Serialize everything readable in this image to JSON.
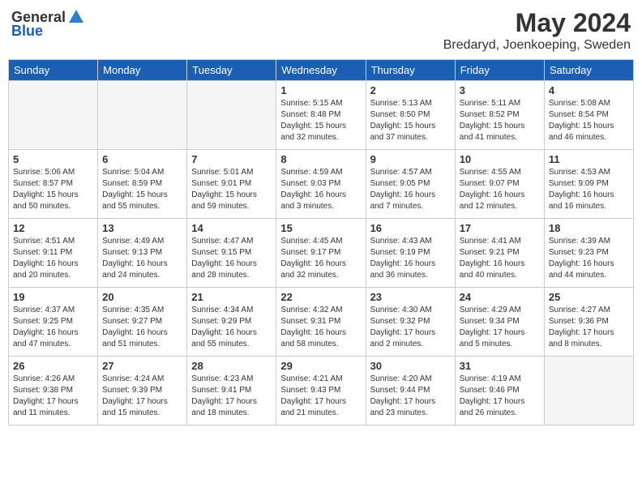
{
  "logo": {
    "general": "General",
    "blue": "Blue",
    "tagline": ""
  },
  "title": {
    "month_year": "May 2024",
    "location": "Bredaryd, Joenkoeping, Sweden"
  },
  "weekdays": [
    "Sunday",
    "Monday",
    "Tuesday",
    "Wednesday",
    "Thursday",
    "Friday",
    "Saturday"
  ],
  "days": [
    {
      "date": "",
      "info": ""
    },
    {
      "date": "",
      "info": ""
    },
    {
      "date": "",
      "info": ""
    },
    {
      "date": "1",
      "sunrise": "Sunrise: 5:15 AM",
      "sunset": "Sunset: 8:48 PM",
      "daylight": "Daylight: 15 hours and 32 minutes."
    },
    {
      "date": "2",
      "sunrise": "Sunrise: 5:13 AM",
      "sunset": "Sunset: 8:50 PM",
      "daylight": "Daylight: 15 hours and 37 minutes."
    },
    {
      "date": "3",
      "sunrise": "Sunrise: 5:11 AM",
      "sunset": "Sunset: 8:52 PM",
      "daylight": "Daylight: 15 hours and 41 minutes."
    },
    {
      "date": "4",
      "sunrise": "Sunrise: 5:08 AM",
      "sunset": "Sunset: 8:54 PM",
      "daylight": "Daylight: 15 hours and 46 minutes."
    },
    {
      "date": "5",
      "sunrise": "Sunrise: 5:06 AM",
      "sunset": "Sunset: 8:57 PM",
      "daylight": "Daylight: 15 hours and 50 minutes."
    },
    {
      "date": "6",
      "sunrise": "Sunrise: 5:04 AM",
      "sunset": "Sunset: 8:59 PM",
      "daylight": "Daylight: 15 hours and 55 minutes."
    },
    {
      "date": "7",
      "sunrise": "Sunrise: 5:01 AM",
      "sunset": "Sunset: 9:01 PM",
      "daylight": "Daylight: 15 hours and 59 minutes."
    },
    {
      "date": "8",
      "sunrise": "Sunrise: 4:59 AM",
      "sunset": "Sunset: 9:03 PM",
      "daylight": "Daylight: 16 hours and 3 minutes."
    },
    {
      "date": "9",
      "sunrise": "Sunrise: 4:57 AM",
      "sunset": "Sunset: 9:05 PM",
      "daylight": "Daylight: 16 hours and 7 minutes."
    },
    {
      "date": "10",
      "sunrise": "Sunrise: 4:55 AM",
      "sunset": "Sunset: 9:07 PM",
      "daylight": "Daylight: 16 hours and 12 minutes."
    },
    {
      "date": "11",
      "sunrise": "Sunrise: 4:53 AM",
      "sunset": "Sunset: 9:09 PM",
      "daylight": "Daylight: 16 hours and 16 minutes."
    },
    {
      "date": "12",
      "sunrise": "Sunrise: 4:51 AM",
      "sunset": "Sunset: 9:11 PM",
      "daylight": "Daylight: 16 hours and 20 minutes."
    },
    {
      "date": "13",
      "sunrise": "Sunrise: 4:49 AM",
      "sunset": "Sunset: 9:13 PM",
      "daylight": "Daylight: 16 hours and 24 minutes."
    },
    {
      "date": "14",
      "sunrise": "Sunrise: 4:47 AM",
      "sunset": "Sunset: 9:15 PM",
      "daylight": "Daylight: 16 hours and 28 minutes."
    },
    {
      "date": "15",
      "sunrise": "Sunrise: 4:45 AM",
      "sunset": "Sunset: 9:17 PM",
      "daylight": "Daylight: 16 hours and 32 minutes."
    },
    {
      "date": "16",
      "sunrise": "Sunrise: 4:43 AM",
      "sunset": "Sunset: 9:19 PM",
      "daylight": "Daylight: 16 hours and 36 minutes."
    },
    {
      "date": "17",
      "sunrise": "Sunrise: 4:41 AM",
      "sunset": "Sunset: 9:21 PM",
      "daylight": "Daylight: 16 hours and 40 minutes."
    },
    {
      "date": "18",
      "sunrise": "Sunrise: 4:39 AM",
      "sunset": "Sunset: 9:23 PM",
      "daylight": "Daylight: 16 hours and 44 minutes."
    },
    {
      "date": "19",
      "sunrise": "Sunrise: 4:37 AM",
      "sunset": "Sunset: 9:25 PM",
      "daylight": "Daylight: 16 hours and 47 minutes."
    },
    {
      "date": "20",
      "sunrise": "Sunrise: 4:35 AM",
      "sunset": "Sunset: 9:27 PM",
      "daylight": "Daylight: 16 hours and 51 minutes."
    },
    {
      "date": "21",
      "sunrise": "Sunrise: 4:34 AM",
      "sunset": "Sunset: 9:29 PM",
      "daylight": "Daylight: 16 hours and 55 minutes."
    },
    {
      "date": "22",
      "sunrise": "Sunrise: 4:32 AM",
      "sunset": "Sunset: 9:31 PM",
      "daylight": "Daylight: 16 hours and 58 minutes."
    },
    {
      "date": "23",
      "sunrise": "Sunrise: 4:30 AM",
      "sunset": "Sunset: 9:32 PM",
      "daylight": "Daylight: 17 hours and 2 minutes."
    },
    {
      "date": "24",
      "sunrise": "Sunrise: 4:29 AM",
      "sunset": "Sunset: 9:34 PM",
      "daylight": "Daylight: 17 hours and 5 minutes."
    },
    {
      "date": "25",
      "sunrise": "Sunrise: 4:27 AM",
      "sunset": "Sunset: 9:36 PM",
      "daylight": "Daylight: 17 hours and 8 minutes."
    },
    {
      "date": "26",
      "sunrise": "Sunrise: 4:26 AM",
      "sunset": "Sunset: 9:38 PM",
      "daylight": "Daylight: 17 hours and 11 minutes."
    },
    {
      "date": "27",
      "sunrise": "Sunrise: 4:24 AM",
      "sunset": "Sunset: 9:39 PM",
      "daylight": "Daylight: 17 hours and 15 minutes."
    },
    {
      "date": "28",
      "sunrise": "Sunrise: 4:23 AM",
      "sunset": "Sunset: 9:41 PM",
      "daylight": "Daylight: 17 hours and 18 minutes."
    },
    {
      "date": "29",
      "sunrise": "Sunrise: 4:21 AM",
      "sunset": "Sunset: 9:43 PM",
      "daylight": "Daylight: 17 hours and 21 minutes."
    },
    {
      "date": "30",
      "sunrise": "Sunrise: 4:20 AM",
      "sunset": "Sunset: 9:44 PM",
      "daylight": "Daylight: 17 hours and 23 minutes."
    },
    {
      "date": "31",
      "sunrise": "Sunrise: 4:19 AM",
      "sunset": "Sunset: 9:46 PM",
      "daylight": "Daylight: 17 hours and 26 minutes."
    },
    {
      "date": "",
      "info": ""
    },
    {
      "date": "",
      "info": ""
    }
  ]
}
